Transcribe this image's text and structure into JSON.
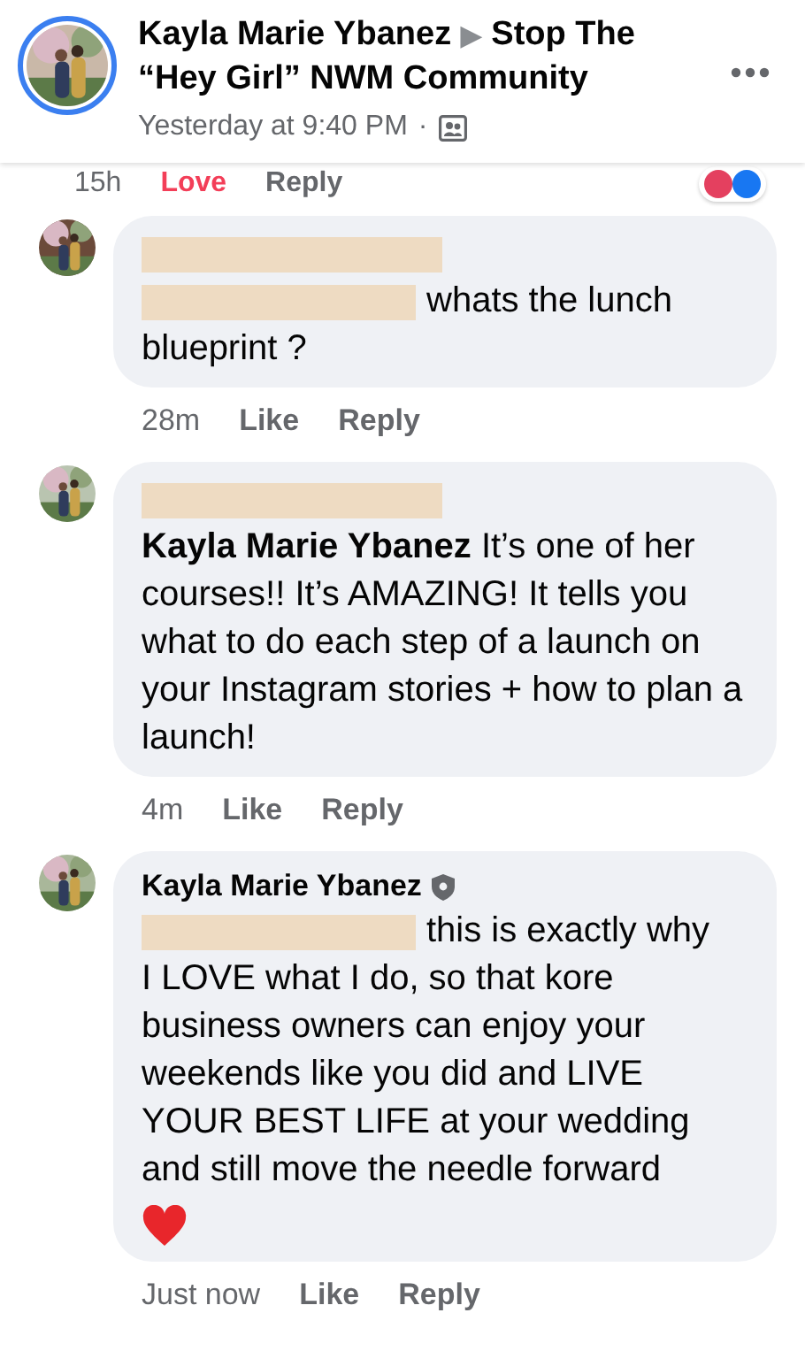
{
  "post_header": {
    "author": "Kayla Marie Ybanez",
    "separator": "▶",
    "group": "Stop The “Hey Girl” NWM Community",
    "time": "Yesterday at 9:40 PM",
    "dot": "·"
  },
  "previous_comment_actions": {
    "time": "15h",
    "reaction": {
      "label": "Love",
      "reacted": true
    },
    "reply": "Reply",
    "reactions": [
      {
        "color": "#e4405f"
      },
      {
        "color": "#1877f2"
      }
    ]
  },
  "comments": [
    {
      "body": [
        {
          "kind": "redaction_line"
        },
        {
          "kind": "redaction_with_text",
          "text": "whats the lunch"
        },
        {
          "kind": "text",
          "text": "blueprint ?"
        }
      ],
      "time": "28m",
      "reaction": {
        "label": "Like",
        "reacted": false
      },
      "reply": "Reply"
    },
    {
      "body": [
        {
          "kind": "redaction_line"
        },
        {
          "kind": "text",
          "text": "**Kayla Marie Ybanez** It’s one of her courses!! It’s AMAZING! It tells you what to do each step of a launch on your Instagram stories + how to plan a launch!"
        }
      ],
      "time": "4m",
      "reaction": {
        "label": "Like",
        "reacted": false
      },
      "reply": "Reply"
    },
    {
      "author": "Kayla Marie Ybanez",
      "body": [
        {
          "kind": "redaction_with_text",
          "text": "this is exactly why"
        },
        {
          "kind": "text",
          "text": "I LOVE what I do, so that kore business owners can enjoy your weekends like you did and LIVE YOUR BEST LIFE at your wedding and still move the needle forward"
        },
        {
          "kind": "heart"
        }
      ],
      "time": "Just now",
      "reaction": {
        "label": "Like",
        "reacted": false
      },
      "reply": "Reply"
    }
  ]
}
